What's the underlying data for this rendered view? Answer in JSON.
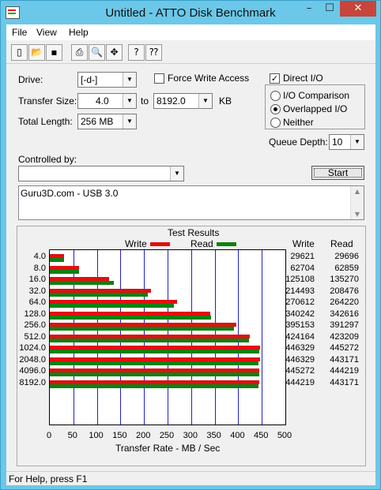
{
  "window": {
    "title": "Untitled - ATTO Disk Benchmark",
    "min": "–",
    "max": "☐",
    "close": "✕"
  },
  "menu": [
    "File",
    "View",
    "Help"
  ],
  "toolbar": {
    "buttons": [
      "new-icon",
      "open-icon",
      "save-icon",
      "print-icon",
      "print-preview-icon",
      "move-icon",
      "help-icon",
      "context-help-icon"
    ],
    "glyphs": [
      "▯",
      "📂",
      "▪",
      "⎙",
      "🔍",
      "✥",
      "?",
      "⁇"
    ]
  },
  "drive": {
    "label": "Drive:",
    "value": "[-d-]"
  },
  "force_write": {
    "label": "Force Write Access",
    "checked": false
  },
  "direct_io": {
    "label": "Direct I/O",
    "checked": true,
    "mark": "✓"
  },
  "transfer_size": {
    "label": "Transfer Size:",
    "from": "4.0",
    "to_label": "to",
    "to": "8192.0",
    "unit": "KB"
  },
  "total_length": {
    "label": "Total Length:",
    "value": "256 MB"
  },
  "io_mode": {
    "options": [
      "I/O Comparison",
      "Overlapped I/O",
      "Neither"
    ],
    "selected": 1
  },
  "queue_depth": {
    "label": "Queue Depth:",
    "value": "10"
  },
  "controlled_by": {
    "label": "Controlled by:",
    "value": ""
  },
  "start_button": "Start",
  "description": "Guru3D.com - USB 3.0",
  "results": {
    "title": "Test Results",
    "legend_write": "Write",
    "legend_read": "Read",
    "col_write": "Write",
    "col_read": "Read",
    "xlabel": "Transfer Rate - MB / Sec",
    "write_color": "#e01010",
    "read_color": "#108010"
  },
  "chart_data": {
    "type": "bar",
    "orientation": "horizontal",
    "categories": [
      "4.0",
      "8.0",
      "16.0",
      "32.0",
      "64.0",
      "128.0",
      "256.0",
      "512.0",
      "1024.0",
      "2048.0",
      "4096.0",
      "8192.0"
    ],
    "series": [
      {
        "name": "Write",
        "values": [
          29621,
          62704,
          125108,
          214493,
          270612,
          340242,
          395153,
          424164,
          446329,
          446329,
          445272,
          444219
        ]
      },
      {
        "name": "Read",
        "values": [
          29696,
          62859,
          135270,
          208476,
          264220,
          342616,
          391297,
          423209,
          445272,
          443171,
          444219,
          443171
        ]
      }
    ],
    "xlabel": "Transfer Rate - MB / Sec",
    "xlim": [
      0,
      500
    ],
    "xticks": [
      "0",
      "50",
      "100",
      "150",
      "200",
      "250",
      "300",
      "350",
      "400",
      "450",
      "500"
    ],
    "grid": true,
    "legend": "top"
  },
  "status": "For Help, press F1"
}
